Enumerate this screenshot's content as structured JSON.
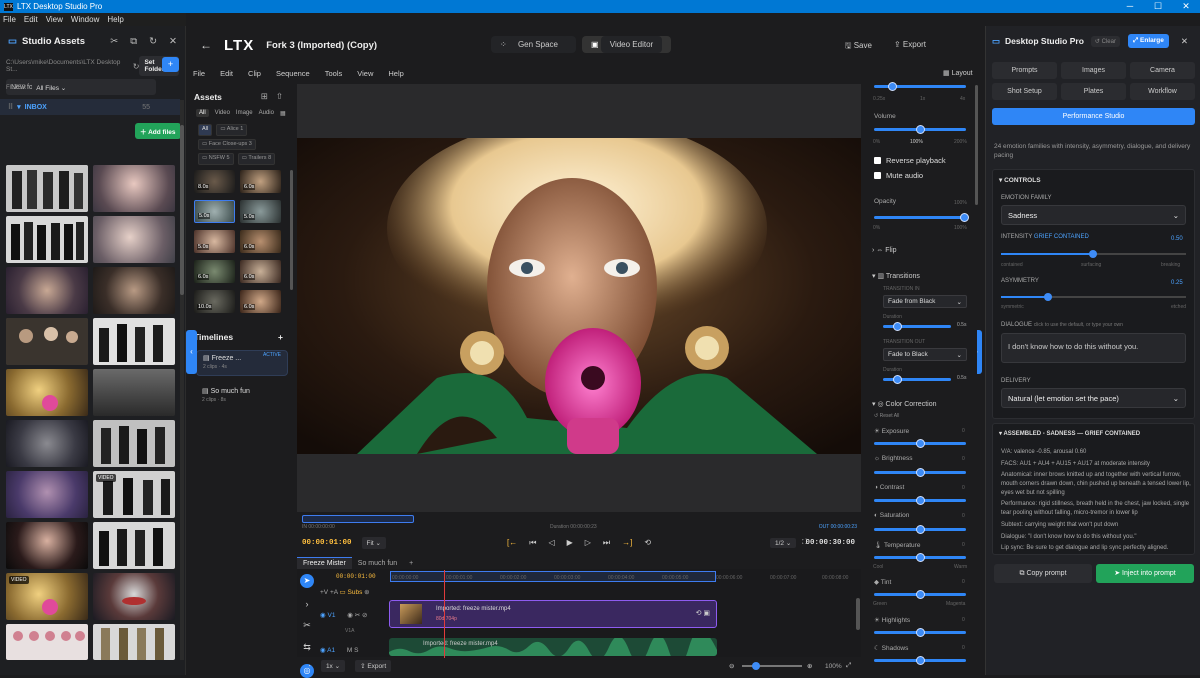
{
  "window": {
    "title": "LTX Desktop Studio Pro",
    "app_badge": "LTX"
  },
  "app_menu": [
    "File",
    "Edit",
    "View",
    "Window",
    "Help"
  ],
  "left_panel": {
    "title": "Studio Assets",
    "path": "C:\\Users\\mike\\Documents\\LTX Desktop St...",
    "set_folder": "Set Folder",
    "new_folder_placeholder": "New folder...",
    "filter_label": "FILTER",
    "filter_value": "All Files",
    "inbox_label": "INBOX",
    "inbox_count": "55",
    "add_files": "Add files",
    "video_badge": "VIDEO"
  },
  "topbar": {
    "logo": "LTX",
    "project_title": "Fork 3 (Imported) (Copy)",
    "gen_space": "Gen Space",
    "video_editor": "Video Editor",
    "save": "Save",
    "export": "Export"
  },
  "editor_menu": [
    "File",
    "Edit",
    "Clip",
    "Sequence",
    "Tools",
    "View",
    "Help"
  ],
  "assets_panel": {
    "title": "Assets",
    "tabs": [
      "All",
      "Video",
      "Image",
      "Audio"
    ],
    "chips": [
      "All",
      "Alice",
      "Face Close-ups",
      "NSFW",
      "Trailers"
    ],
    "chip_counts": [
      "1",
      "3",
      "5",
      "8"
    ],
    "thumb_durations": [
      "8.0s",
      "6.0s",
      "5.0s",
      "5.0s",
      "5.0s",
      "6.0s",
      "6.0s",
      "6.0s",
      "10.0s",
      "6.0s"
    ]
  },
  "timelines": {
    "title": "Timelines",
    "items": [
      {
        "name": "Freeze ...",
        "sub": "2 clips · 4s",
        "status": "ACTIVE"
      },
      {
        "name": "So much fun",
        "sub": "2 clips · 8s",
        "status": ""
      }
    ]
  },
  "layout_btn": "Layout",
  "scrub": {
    "in": "IN 00:00:00:00",
    "duration": "Duration 00:00:00:23",
    "out": "OUT 00:00:00:23"
  },
  "transport": {
    "timecode": "00:00:01:00",
    "fit": "Fit",
    "ratio": "1/2",
    "end_timecode": "00:00:30:00"
  },
  "timeline_tabs": [
    "Freeze Mister",
    "So much fun"
  ],
  "timeline": {
    "playhead_tc": "00:00:01:00",
    "ruler": [
      "00:00:00:00",
      "00:00:01:00",
      "00:00:02:00",
      "00:00:03:00",
      "00:00:04:00",
      "00:00:05:00",
      "00:00:06:00",
      "00:00:07:00",
      "00:00:08:00"
    ],
    "subs": "Subs",
    "v1": "V1",
    "a1": "A1",
    "v1a": "V1A",
    "video_clip": "Imported: freeze mister.mp4",
    "video_meta": "80d  704p",
    "audio_clip": "Imported: freeze mister.mp4",
    "speed": "1x",
    "export": "Export",
    "zoom": "100%"
  },
  "props": {
    "speed_ticks": [
      "0.25x",
      "1x",
      "4x"
    ],
    "volume": "Volume",
    "volume_ticks": [
      "0%",
      "100%",
      "200%"
    ],
    "reverse": "Reverse playback",
    "mute": "Mute audio",
    "opacity": "Opacity",
    "opacity_val": "100%",
    "opacity_ticks": [
      "0%",
      "100%"
    ],
    "flip": "Flip",
    "transitions": "Transitions",
    "transition_in": "TRANSITION IN",
    "transition_in_val": "Fade from Black",
    "transition_out": "TRANSITION OUT",
    "transition_out_val": "Fade to Black",
    "duration": "Duration",
    "duration_val": "0.5s",
    "color_correction": "Color Correction",
    "reset_all": "Reset All",
    "cc_items": [
      "Exposure",
      "Brightness",
      "Contrast",
      "Saturation",
      "Temperature",
      "Tint",
      "Highlights",
      "Shadows"
    ],
    "cc_value": "0",
    "temp_ticks": [
      "Cool",
      "Warm"
    ],
    "tint_ticks": [
      "Green",
      "Magenta"
    ]
  },
  "studio": {
    "title": "Desktop Studio Pro",
    "clear": "Clear",
    "enlarge": "Enlarge",
    "tabs": [
      "Prompts",
      "Images",
      "Camera",
      "Shot Setup",
      "Plates",
      "Workflow"
    ],
    "performance": "Performance Studio",
    "desc": "24 emotion families with intensity, asymmetry, dialogue, and delivery pacing",
    "controls": "CONTROLS",
    "emotion_label": "EMOTION FAMILY",
    "emotion_value": "Sadness",
    "intensity_label": "INTENSITY",
    "intensity_tag": "GRIEF CONTAINED",
    "intensity_value": "0.50",
    "intensity_ticks": [
      "contained",
      "surfacing",
      "breaking"
    ],
    "asym_label": "ASYMMETRY",
    "asym_value": "0.25",
    "asym_ticks": [
      "symmetric",
      "etched"
    ],
    "dialogue_label": "DIALOGUE",
    "dialogue_hint": "click to use the default, or type your own",
    "dialogue_value": "I don't know how to do this without you.",
    "delivery_label": "DELIVERY",
    "delivery_value": "Natural (let emotion set the pace)",
    "assembled_title": "ASSEMBLED - SADNESS — GRIEF CONTAINED",
    "assembled_lines": [
      "V/A: valence -0.85, arousal 0.60",
      "FACS: AU1 + AU4 + AU15 + AU17 at moderate intensity",
      "Anatomical: inner brows knitted up and together with vertical furrow, mouth corners drawn down, chin pushed up beneath a tensed lower lip, eyes wet but not spilling",
      "Performance: rigid stillness, breath held in the chest, jaw locked, single tear pooling without falling, micro-tremor in lower lip",
      "Subtext: carrying weight that won't put down",
      "Dialogue: \"I don't know how to do this without you.\"",
      "Lip sync: Be sure to get dialogue and lip sync perfectly aligned."
    ],
    "copy_prompt": "Copy prompt",
    "inject": "Inject into prompt"
  }
}
